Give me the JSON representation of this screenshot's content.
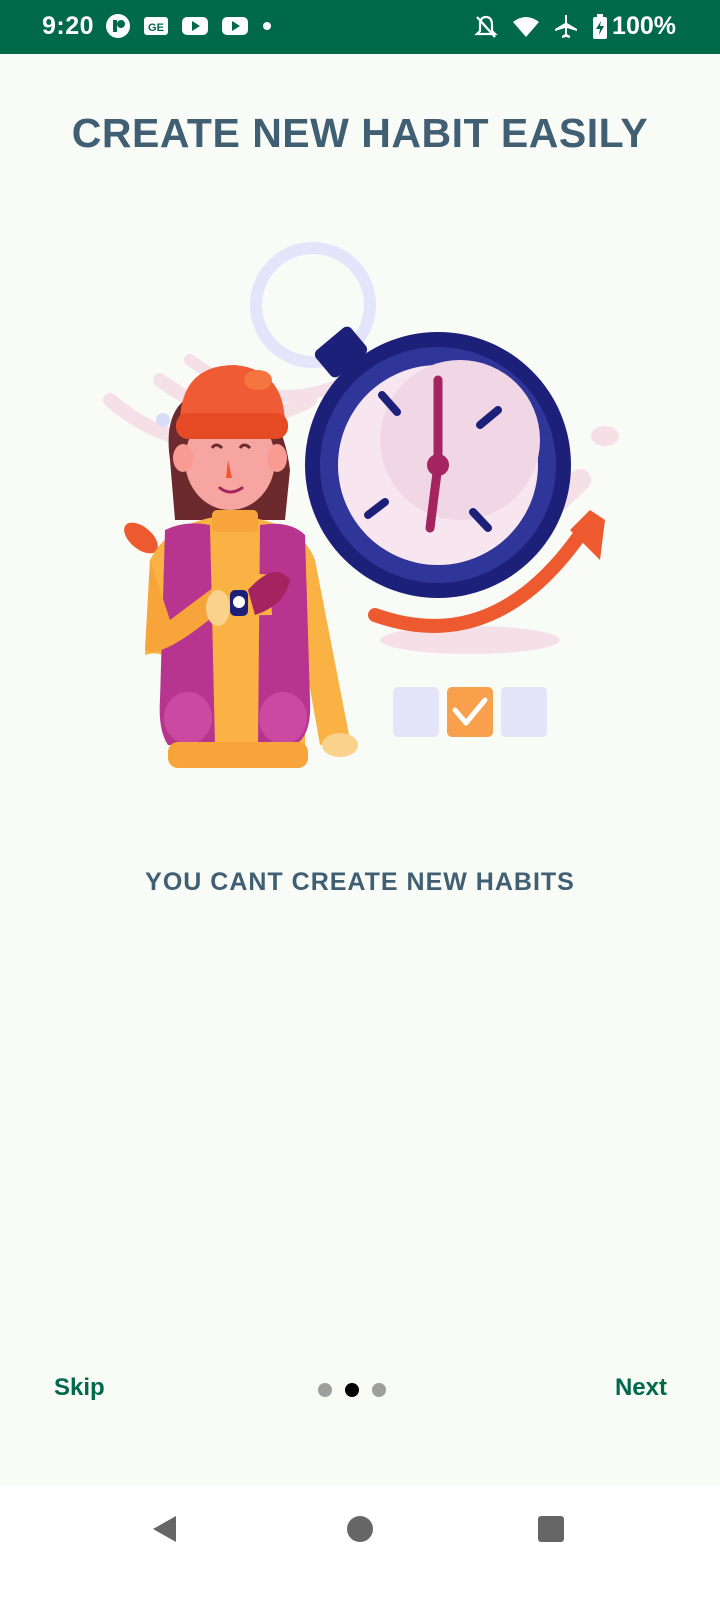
{
  "status_bar": {
    "time": "9:20",
    "left_icons": [
      "app-notification-icon",
      "news-icon",
      "youtube-icon",
      "youtube-icon",
      "dot-icon"
    ],
    "right_icons": [
      "notifications-off-icon",
      "wifi-icon",
      "airplane-mode-icon",
      "battery-charging-icon"
    ],
    "battery": "100%",
    "background_color": "#00694a"
  },
  "onboarding": {
    "title": "CREATE NEW HABIT EASILY",
    "subtitle": "YOU CANT CREATE NEW HABITS",
    "illustration": "woman-with-stopwatch-illustration",
    "page_count": 3,
    "current_page": 2,
    "skip_label": "Skip",
    "next_label": "Next",
    "title_color": "#415f73",
    "action_color": "#00694a"
  },
  "nav_bar": {
    "buttons": [
      "back-icon",
      "home-icon",
      "recents-icon"
    ]
  }
}
